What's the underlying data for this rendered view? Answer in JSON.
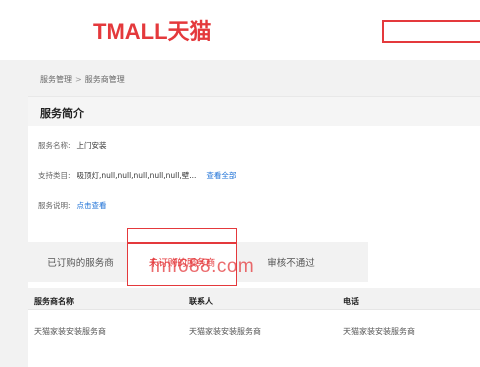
{
  "header": {
    "logo_text": "TMALL天猫",
    "search_placeholder": ""
  },
  "breadcrumb": {
    "items": [
      "服务管理",
      "服务商管理"
    ],
    "separator": ">"
  },
  "panel": {
    "title": "服务简介",
    "service_name_label": "服务名称:",
    "service_name_value": "上门安装",
    "category_label": "支持类目:",
    "category_value": "吸顶灯,null,null,null,null,null,壁...",
    "view_all_link": "查看全部",
    "description_label": "服务说明:",
    "description_link": "点击查看"
  },
  "tabs": [
    {
      "label": "已订购的服务商",
      "active": false
    },
    {
      "label": "未订购的服务商",
      "active": true
    },
    {
      "label": "审核不通过",
      "active": false
    }
  ],
  "watermark": "fmf688.com",
  "table": {
    "headers": [
      "服务商名称",
      "联系人",
      "电话"
    ],
    "rows": [
      [
        "天猫家装安装服务商",
        "天猫家装安装服务商",
        "天猫家装安装服务商"
      ]
    ]
  },
  "colors": {
    "brand": "#e4393c",
    "link": "#1a6fd6"
  }
}
